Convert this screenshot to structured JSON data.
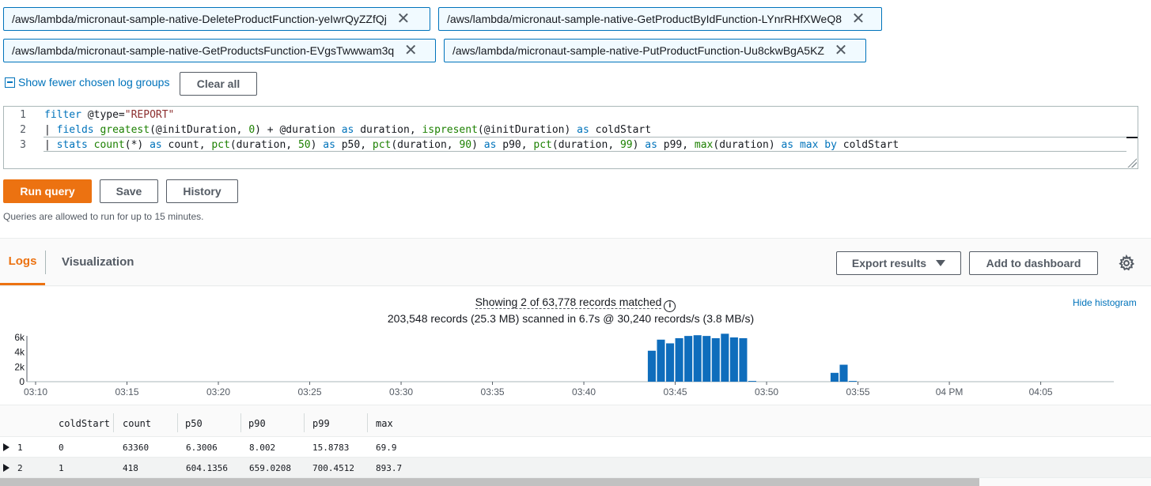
{
  "log_groups": [
    "/aws/lambda/micronaut-sample-native-DeleteProductFunction-yeIwrQyZZfQj",
    "/aws/lambda/micronaut-sample-native-GetProductByIdFunction-LYnrRHfXWeQ8",
    "/aws/lambda/micronaut-sample-native-GetProductsFunction-EVgsTwwwam3q",
    "/aws/lambda/micronaut-sample-native-PutProductFunction-Uu8ckwBgA5KZ"
  ],
  "remove_symbol": "✕",
  "show_fewer_label": "Show fewer chosen log groups",
  "clear_all_label": "Clear all",
  "query": {
    "line_numbers": [
      "1",
      "2",
      "3"
    ],
    "lines": [
      "filter @type=\"REPORT\"",
      "| fields greatest(@initDuration, 0) + @duration as duration, ispresent(@initDuration) as coldStart",
      "| stats count(*) as count, pct(duration, 50) as p50, pct(duration, 90) as p90, pct(duration, 99) as p99, max(duration) as max by coldStart"
    ]
  },
  "actions": {
    "run_query": "Run query",
    "save": "Save",
    "history": "History"
  },
  "limit_note": "Queries are allowed to run for up to 15 minutes.",
  "tabs": {
    "logs": "Logs",
    "visualization": "Visualization"
  },
  "export_results": "Export results",
  "add_to_dashboard": "Add to dashboard",
  "summary": {
    "showing": "Showing 2 of 63,778 records matched",
    "scanned": "203,548 records (25.3 MB) scanned in 6.7s @ 30,240 records/s (3.8 MB/s)"
  },
  "hide_histogram": "Hide histogram",
  "chart_data": {
    "type": "bar",
    "y_ticks": [
      "6k",
      "4k",
      "2k",
      "0"
    ],
    "y_max": 6000,
    "x_ticks": [
      "03:10",
      "03:15",
      "03:20",
      "03:25",
      "03:30",
      "03:35",
      "03:40",
      "03:45",
      "03:50",
      "03:55",
      "04 PM",
      "04:05"
    ],
    "x_domain_minutes": [
      190,
      249
    ],
    "bin_minutes": 0.5,
    "bins": [
      {
        "t": 223.5,
        "v": 4200
      },
      {
        "t": 224,
        "v": 5700
      },
      {
        "t": 224.5,
        "v": 5200
      },
      {
        "t": 225,
        "v": 5900
      },
      {
        "t": 225.5,
        "v": 6200
      },
      {
        "t": 226,
        "v": 6300
      },
      {
        "t": 226.5,
        "v": 6200
      },
      {
        "t": 227,
        "v": 5900
      },
      {
        "t": 227.5,
        "v": 6500
      },
      {
        "t": 228,
        "v": 6000
      },
      {
        "t": 228.5,
        "v": 5900
      },
      {
        "t": 229,
        "v": 100
      },
      {
        "t": 233.5,
        "v": 1200
      },
      {
        "t": 234,
        "v": 2300
      },
      {
        "t": 234.5,
        "v": 100
      }
    ],
    "color": "#0f6dbc"
  },
  "table": {
    "columns": [
      "coldStart",
      "count",
      "p50",
      "p90",
      "p99",
      "max"
    ],
    "rows": [
      {
        "index": "1",
        "coldStart": "0",
        "count": "63360",
        "p50": "6.3006",
        "p90": "8.002",
        "p99": "15.8783",
        "max": "69.9"
      },
      {
        "index": "2",
        "coldStart": "1",
        "count": "418",
        "p50": "604.1356",
        "p90": "659.0208",
        "p99": "700.4512",
        "max": "893.7"
      }
    ]
  }
}
